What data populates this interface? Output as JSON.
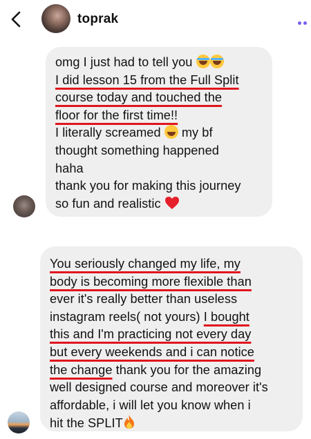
{
  "header": {
    "name": "toprak"
  },
  "message1": {
    "lines": [
      "omg I just had to tell you",
      "I did lesson 15 from the Full Split",
      "course today and touched the",
      "floor for the first time!!",
      "I literally screamed",
      "my bf",
      "thought something happened",
      "haha",
      "thank you for making this journey",
      "so fun and realistic"
    ]
  },
  "message2": {
    "lines": [
      "You seriously changed my life, my",
      "body is becoming more flexible than",
      "ever it's really better than useless",
      "instagram reels( not yours)",
      "I bought",
      "this and I'm practicing not every day",
      "but every weekends and i can notice",
      "the change",
      "thank you for the amazing",
      "well designed course and moreover it's",
      "affordable, i will let you know when i",
      "hit the SPLIT"
    ]
  },
  "icons": {
    "back": "chevron-left-icon",
    "more": "more-dots-icon",
    "emoji_cry": "loudly-crying-face-emoji",
    "emoji_laugh": "tears-of-joy-emoji",
    "emoji_heart": "red-heart-emoji",
    "emoji_fire": "fire-emoji"
  },
  "colors": {
    "accent": "#7b5cf5",
    "underline": "#e0141d",
    "bubble": "#efefef"
  }
}
